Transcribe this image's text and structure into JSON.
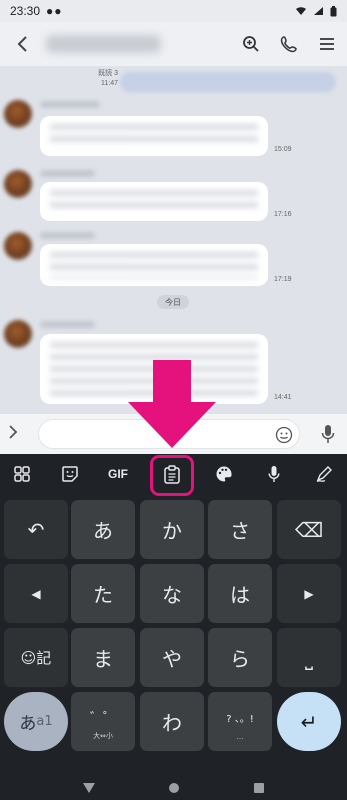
{
  "status_bar": {
    "time": "23:30"
  },
  "chat": {
    "read_receipt": "既読 3",
    "read_time": "11:47",
    "today_label": "今日",
    "messages": [
      {
        "time": "15:09"
      },
      {
        "time": "17:16"
      },
      {
        "time": "17:19"
      },
      {
        "time": "14:41"
      }
    ]
  },
  "keyboard": {
    "toolbar": {
      "gif_label": "GIF"
    },
    "keys": {
      "undo": "↶",
      "a": "あ",
      "ka": "か",
      "sa": "さ",
      "backspace": "⌫",
      "left": "◀",
      "ta": "た",
      "na": "な",
      "ha": "は",
      "right": "▶",
      "emoji_symbol": "☺記",
      "ma": "ま",
      "ya": "や",
      "ra": "ら",
      "space": "⎵",
      "mode_main": "あ",
      "mode_alt": "a1",
      "dakuten_main": "゛゜",
      "dakuten_sub": "大⇔小",
      "wa": "わ",
      "punct_main": "? 、。!",
      "punct_sub": "…",
      "enter": "↵"
    }
  },
  "colors": {
    "highlight": "#e5127d",
    "enter_key": "#c6e0f6"
  }
}
